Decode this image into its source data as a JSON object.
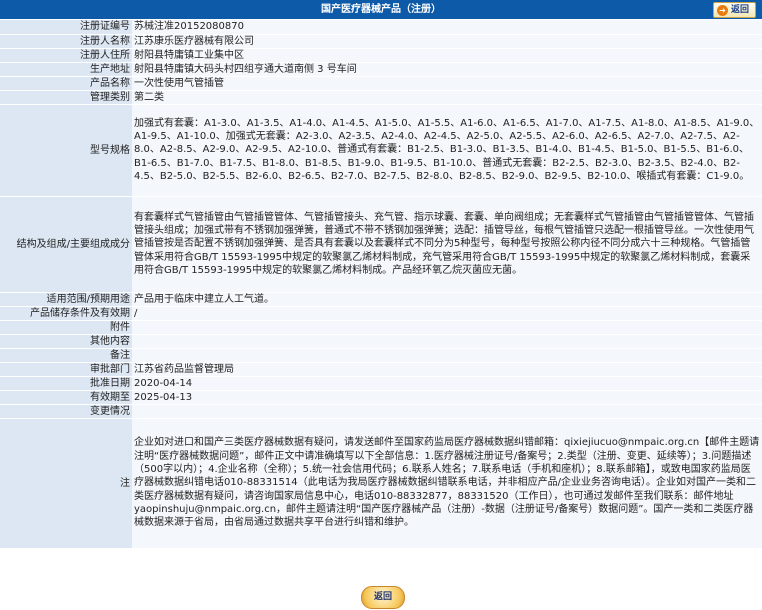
{
  "header": {
    "title": "国产医疗器械产品（注册）",
    "back_label": "返回"
  },
  "rows": [
    {
      "label": "注册证编号",
      "value": "苏械注准20152080870"
    },
    {
      "label": "注册人名称",
      "value": "江苏康乐医疗器械有限公司"
    },
    {
      "label": "注册人住所",
      "value": "射阳县特庸镇工业集中区"
    },
    {
      "label": "生产地址",
      "value": "射阳县特庸镇大码头村四组亨通大道南侧 3 号车间"
    },
    {
      "label": "产品名称",
      "value": "一次性使用气管插管"
    },
    {
      "label": "管理类别",
      "value": "第二类"
    },
    {
      "label": "型号规格",
      "value": "加强式有套囊：A1-3.0、A1-3.5、A1-4.0、A1-4.5、A1-5.0、A1-5.5、A1-6.0、A1-6.5、A1-7.0、A1-7.5、A1-8.0、A1-8.5、A1-9.0、A1-9.5、A1-10.0、加强式无套囊：A2-3.0、A2-3.5、A2-4.0、A2-4.5、A2-5.0、A2-5.5、A2-6.0、A2-6.5、A2-7.0、A2-7.5、A2-8.0、A2-8.5、A2-9.0、A2-9.5、A2-10.0、普通式有套囊：B1-2.5、B1-3.0、B1-3.5、B1-4.0、B1-4.5、B1-5.0、B1-5.5、B1-6.0、B1-6.5、B1-7.0、B1-7.5、B1-8.0、B1-8.5、B1-9.0、B1-9.5、B1-10.0、普通式无套囊：B2-2.5、B2-3.0、B2-3.5、B2-4.0、B2-4.5、B2-5.0、B2-5.5、B2-6.0、B2-6.5、B2-7.0、B2-7.5、B2-8.0、B2-8.5、B2-9.0、B2-9.5、B2-10.0、喉插式有套囊：C1-9.0。"
    },
    {
      "label": "结构及组成/主要组成成分",
      "value": "有套囊样式气管插管由气管插管管体、气管插管接头、充气管、指示球囊、套囊、单向阀组成；无套囊样式气管插管由气管插管管体、气管插管接头组成；加强式带有不锈钢加强弹簧，普通式不带不锈钢加强弹簧；选配：插管导丝，每根气管插管只选配一根插管导丝。一次性使用气管插管按是否配置不锈钢加强弹簧、是否具有套囊以及套囊样式不同分为5种型号，每种型号按照公称内径不同分成六十三种规格。气管插管管体采用符合GB/T 15593-1995中规定的软聚氯乙烯材料制成，充气管采用符合GB/T 15593-1995中规定的软聚氯乙烯材料制成，套囊采用符合GB/T 15593-1995中规定的软聚氯乙烯材料制成。产品经环氧乙烷灭菌应无菌。"
    },
    {
      "label": "适用范围/预期用途",
      "value": "产品用于临床中建立人工气道。"
    },
    {
      "label": "产品储存条件及有效期",
      "value": "/"
    },
    {
      "label": "附件",
      "value": ""
    },
    {
      "label": "其他内容",
      "value": ""
    },
    {
      "label": "备注",
      "value": ""
    },
    {
      "label": "审批部门",
      "value": "江苏省药品监督管理局"
    },
    {
      "label": "批准日期",
      "value": "2020-04-14"
    },
    {
      "label": "有效期至",
      "value": "2025-04-13"
    },
    {
      "label": "变更情况",
      "value": ""
    },
    {
      "label": "注",
      "value": "企业如对进口和国产三类医疗器械数据有疑问，请发送邮件至国家药监局医疗器械数据纠错邮箱：qixiejiucuo@nmpaic.org.cn【邮件主题请注明“医疗器械数据问题”，邮件正文中请准确填写以下全部信息：1.医疗器械注册证号/备案号；2.类型（注册、变更、延续等）；3.问题描述（500字以内）；4.企业名称（全称）；5.统一社会信用代码；6.联系人姓名；7.联系电话（手机和座机）；8.联系邮箱】，或致电国家药监局医疗器械数据纠错电话010-88331514（此电话为我局医疗器械数据纠错联系电话，并非相应产品/企业业务咨询电话）。企业如对国产一类和二类医疗器械数据有疑问，请咨询国家局信息中心，电话010-88332877，88331520（工作日），也可通过发邮件至我们联系：邮件地址yaopinshuju@nmpaic.org.cn，邮件主题请注明“国产医疗器械产品（注册）-数据（注册证号/备案号）数据问题”。国产一类和二类医疗器械数据来源于省局，由省局通过数据共享平台进行纠错和维护。"
    }
  ],
  "footer": {
    "back_label": "返回"
  }
}
